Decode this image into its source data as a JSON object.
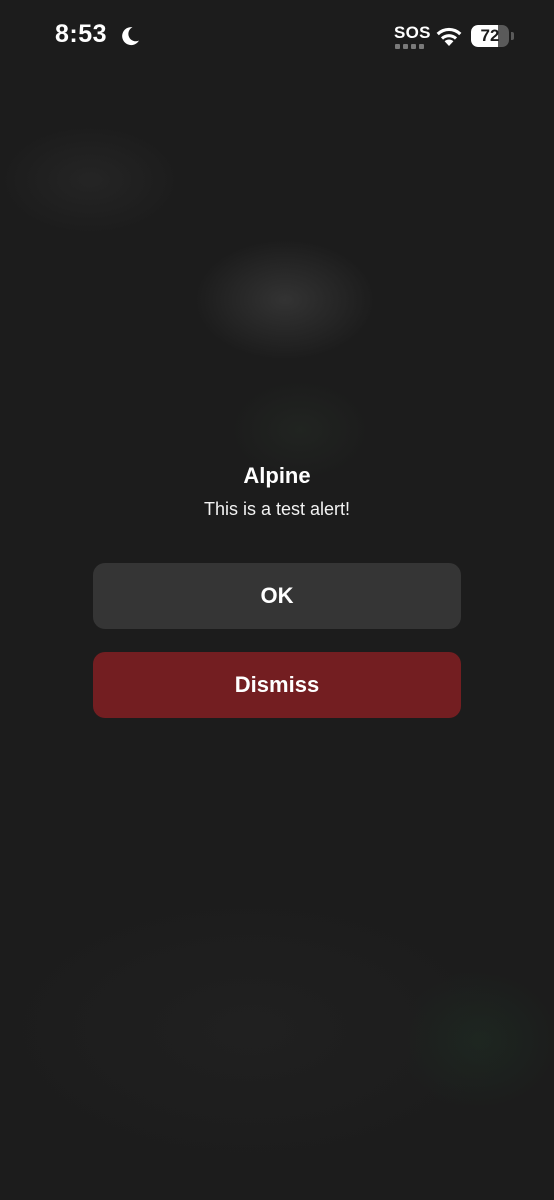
{
  "status_bar": {
    "time": "8:53",
    "focus_icon": "moon-icon",
    "sos_label": "SOS",
    "wifi_icon": "wifi-icon",
    "battery_level": "72",
    "battery_fraction": 0.72
  },
  "alert": {
    "title": "Alpine",
    "message": "This is a test alert!",
    "ok_label": "OK",
    "dismiss_label": "Dismiss"
  },
  "colors": {
    "background": "#1c1c1c",
    "ok_button": "#353535",
    "dismiss_button": "#731e21",
    "text": "#ffffff"
  }
}
